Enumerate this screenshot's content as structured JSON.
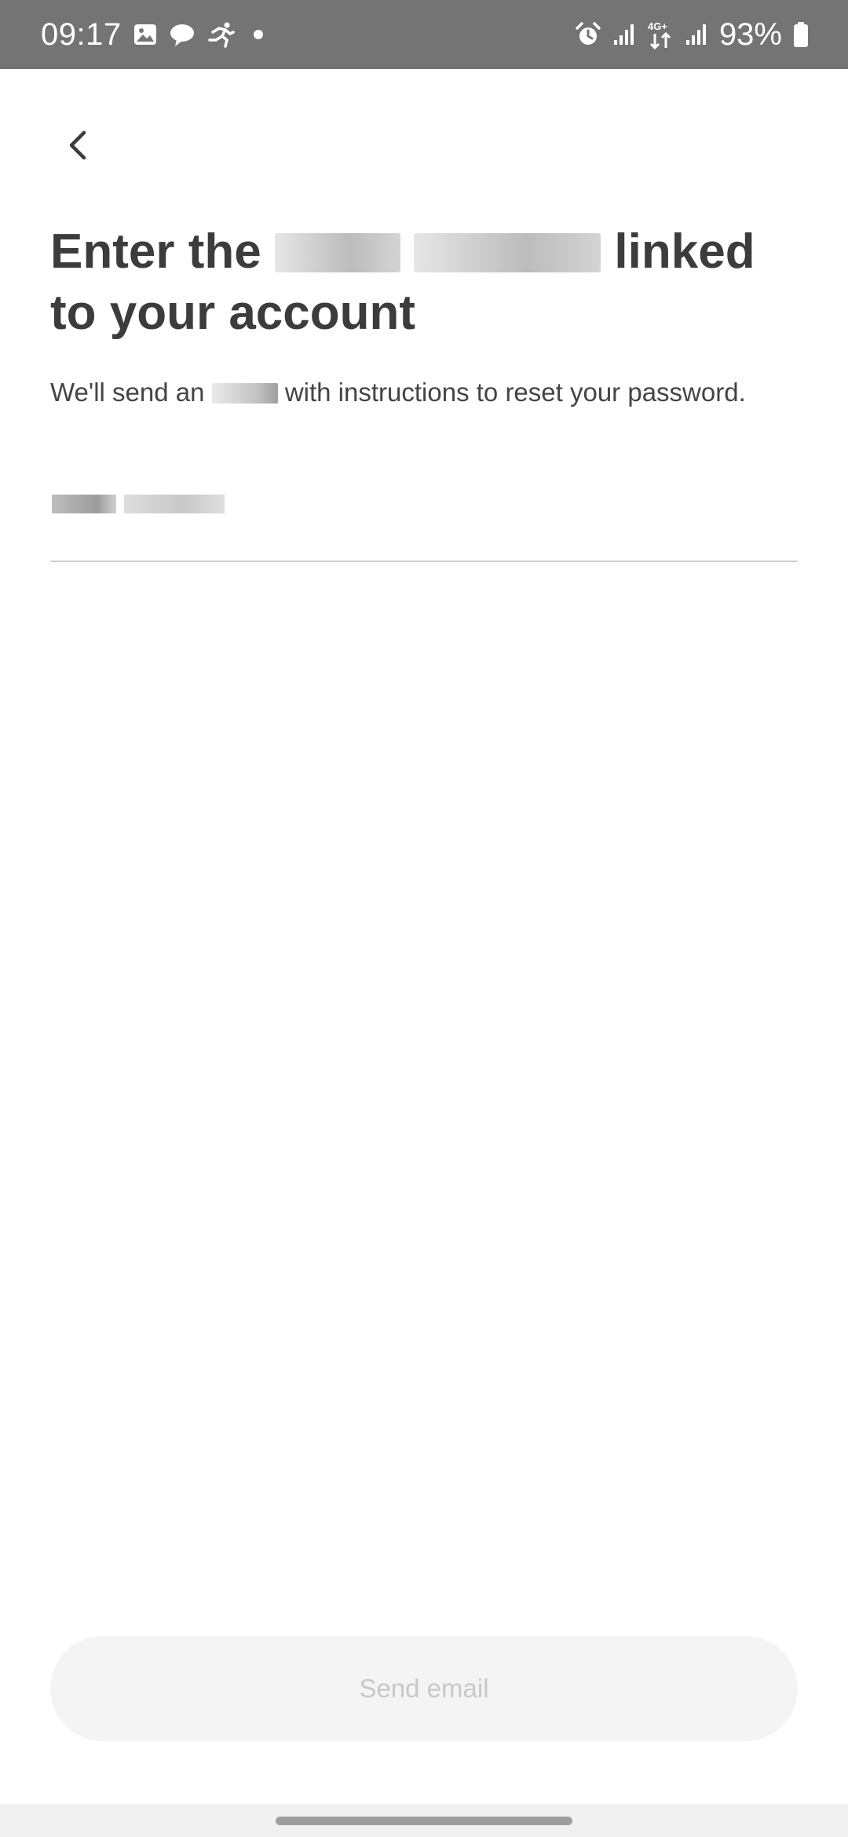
{
  "status_bar": {
    "time": "09:17",
    "battery_percent": "93%",
    "network": "4G+",
    "left_icons": [
      "image-icon",
      "chat-bubble-icon",
      "running-icon",
      "dot-icon"
    ],
    "right_icons": [
      "alarm-icon",
      "signal-icon",
      "data-arrows-icon",
      "signal-icon",
      "battery-icon"
    ]
  },
  "header": {
    "back_icon": "chevron-left-icon"
  },
  "content": {
    "title_part1": "Enter the",
    "title_part2": "linked",
    "title_part3": "to your account",
    "subtitle_part1": "We'll send an",
    "subtitle_part2": "with instructions to reset your password."
  },
  "form": {
    "email_value": "",
    "email_placeholder": ""
  },
  "footer": {
    "send_label": "Send email"
  },
  "colors": {
    "status_bar_bg": "#747474",
    "text_primary": "#3c3c3c",
    "button_disabled_bg": "#f4f4f4",
    "button_disabled_text": "#c8c8c8",
    "divider": "#cfcfcf"
  }
}
